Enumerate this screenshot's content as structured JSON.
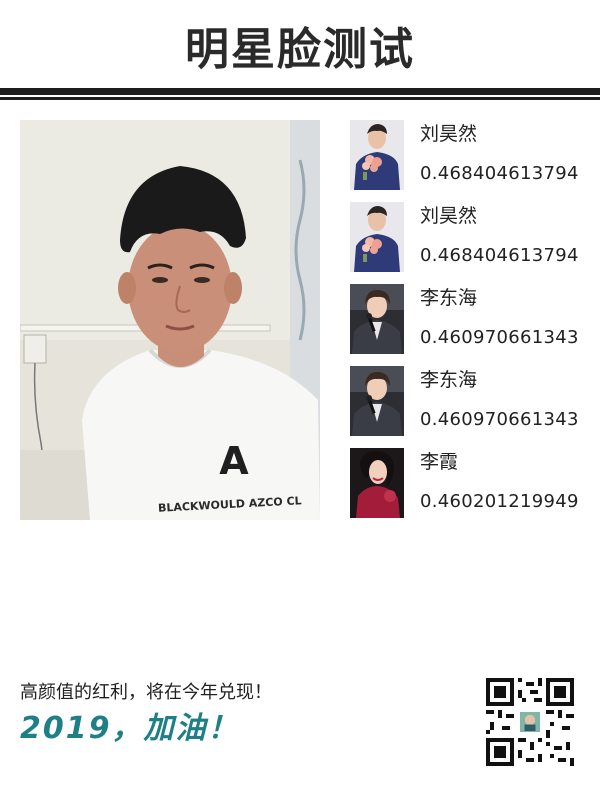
{
  "page": {
    "title": "明星脸测试"
  },
  "photo": {
    "shirt_letter": "A",
    "shirt_text": "BLACKWOULD AZCO CL"
  },
  "matches": [
    {
      "name": "刘昊然",
      "score": "0.468404613794",
      "thumb": "man-holding-flowers"
    },
    {
      "name": "刘昊然",
      "score": "0.468404613794",
      "thumb": "man-holding-flowers"
    },
    {
      "name": "李东海",
      "score": "0.460970661343",
      "thumb": "man-with-microphone"
    },
    {
      "name": "李东海",
      "score": "0.460970661343",
      "thumb": "man-with-microphone"
    },
    {
      "name": "李霞",
      "score": "0.460201219949",
      "thumb": "woman-red-dress"
    }
  ],
  "footer": {
    "line1": "高颜值的红利，将在今年兑现！",
    "line2": "2019，加油！"
  },
  "colors": {
    "accent": "#1e7f86",
    "title": "#2a2a2a",
    "rule": "#1e1e1e"
  },
  "qr": {
    "icon": "qr-code-icon"
  }
}
